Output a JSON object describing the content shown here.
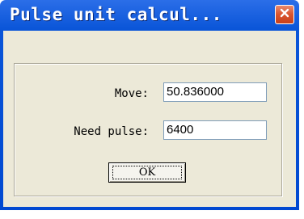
{
  "window": {
    "title": "Pulse unit calcul...",
    "titlebar_color": "#0149d1",
    "close_icon": "close-icon"
  },
  "form": {
    "move_label": "Move:",
    "move_value": "50.836000",
    "need_pulse_label": "Need pulse:",
    "need_pulse_value": "6400"
  },
  "buttons": {
    "ok_label": "OK"
  }
}
